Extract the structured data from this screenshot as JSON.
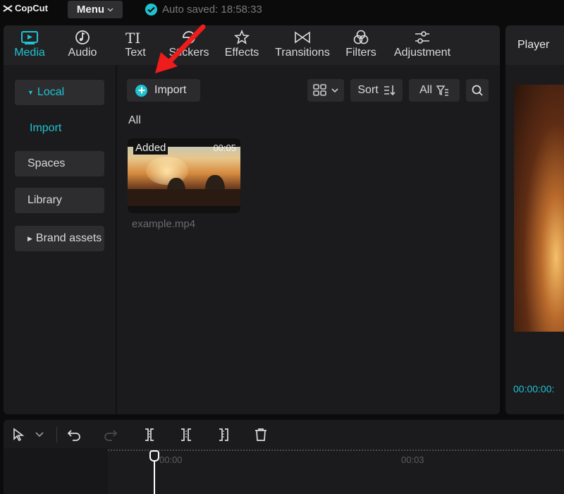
{
  "app": {
    "logo": "CopCut",
    "menu_label": "Menu",
    "autosave_text": "Auto saved: 18:58:33"
  },
  "toolbar": {
    "tabs": [
      {
        "label": "Media",
        "icon": "media-icon",
        "active": true
      },
      {
        "label": "Audio",
        "icon": "audio-icon",
        "active": false
      },
      {
        "label": "Text",
        "icon": "text-icon",
        "active": false
      },
      {
        "label": "Stickers",
        "icon": "stickers-icon",
        "active": false
      },
      {
        "label": "Effects",
        "icon": "effects-icon",
        "active": false
      },
      {
        "label": "Transitions",
        "icon": "transitions-icon",
        "active": false
      },
      {
        "label": "Filters",
        "icon": "filters-icon",
        "active": false
      },
      {
        "label": "Adjustment",
        "icon": "adjustment-icon",
        "active": false
      }
    ]
  },
  "sidebar": {
    "local": "Local",
    "import": "Import",
    "spaces": "Spaces",
    "library": "Library",
    "brand_assets": "Brand assets"
  },
  "media": {
    "import_label": "Import",
    "sort_label": "Sort",
    "filter_label": "All",
    "section_label": "All",
    "items": [
      {
        "file_name": "example.mp4",
        "badge": "Added",
        "duration": "00:05"
      }
    ]
  },
  "player": {
    "title": "Player",
    "time": "00:00:00:"
  },
  "timeline": {
    "ruler_labels": [
      "00:00",
      "00:03"
    ]
  },
  "colors": {
    "accent": "#1fc2d0",
    "annotation": "#ee1c1c",
    "panel": "#1b1b1d",
    "background": "#0b0b0c"
  }
}
